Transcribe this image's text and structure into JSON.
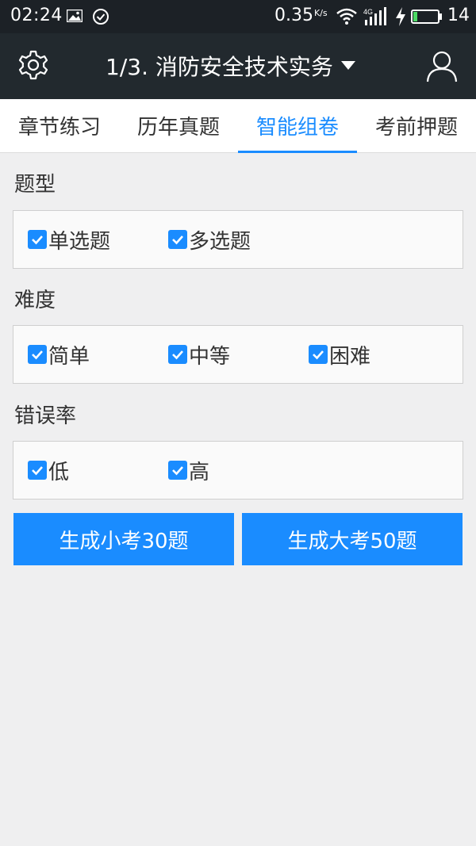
{
  "status_bar": {
    "time": "02:24",
    "net_speed": "0.35",
    "net_unit": "K/s",
    "network_type": "4G",
    "battery_level": "14",
    "icons": [
      "image-icon",
      "check-circle-icon",
      "wifi-icon",
      "signal-icon",
      "charging-icon",
      "battery-icon"
    ]
  },
  "app_bar": {
    "title": "1/3. 消防安全技术实务",
    "icons": [
      "gear-icon",
      "dropdown-caret-icon",
      "user-icon"
    ]
  },
  "tabs": [
    {
      "label": "章节练习",
      "active": false
    },
    {
      "label": "历年真题",
      "active": false
    },
    {
      "label": "智能组卷",
      "active": true
    },
    {
      "label": "考前押题",
      "active": false
    }
  ],
  "sections": {
    "type": {
      "label": "题型",
      "options": [
        {
          "label": "单选题",
          "checked": true
        },
        {
          "label": "多选题",
          "checked": true
        }
      ]
    },
    "difficulty": {
      "label": "难度",
      "options": [
        {
          "label": "简单",
          "checked": true
        },
        {
          "label": "中等",
          "checked": true
        },
        {
          "label": "困难",
          "checked": true
        }
      ]
    },
    "error_rate": {
      "label": "错误率",
      "options": [
        {
          "label": "低",
          "checked": true
        },
        {
          "label": "高",
          "checked": true
        }
      ]
    }
  },
  "buttons": {
    "small_exam": "生成小考30题",
    "big_exam": "生成大考50题"
  },
  "colors": {
    "accent": "#1a8cff",
    "app_bar": "#22292e",
    "status_bar": "#1c2126",
    "background": "#efeff0"
  }
}
